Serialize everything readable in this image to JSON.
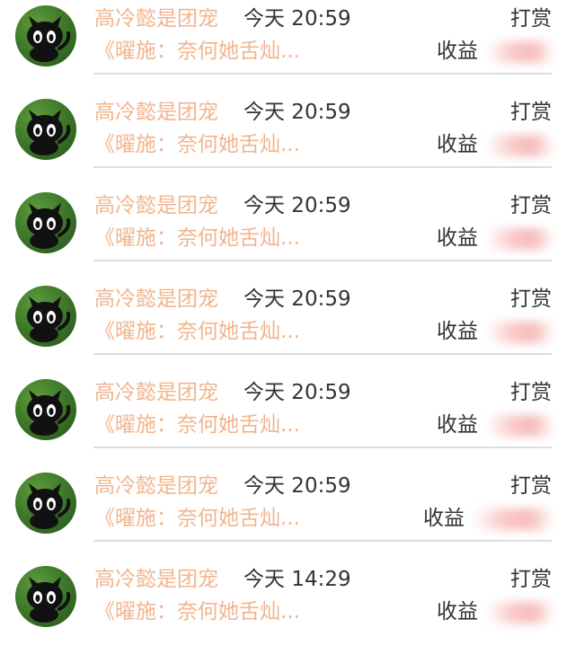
{
  "rewards": [
    {
      "name": "高冷懿是团宠",
      "time": "今天 20:59",
      "type": "打赏",
      "title": "《曜施：奈何她舌灿...",
      "income_label": "收益"
    },
    {
      "name": "高冷懿是团宠",
      "time": "今天 20:59",
      "type": "打赏",
      "title": "《曜施：奈何她舌灿...",
      "income_label": "收益"
    },
    {
      "name": "高冷懿是团宠",
      "time": "今天 20:59",
      "type": "打赏",
      "title": "《曜施：奈何她舌灿...",
      "income_label": "收益"
    },
    {
      "name": "高冷懿是团宠",
      "time": "今天 20:59",
      "type": "打赏",
      "title": "《曜施：奈何她舌灿...",
      "income_label": "收益"
    },
    {
      "name": "高冷懿是团宠",
      "time": "今天 20:59",
      "type": "打赏",
      "title": "《曜施：奈何她舌灿...",
      "income_label": "收益"
    },
    {
      "name": "高冷懿是团宠",
      "time": "今天 20:59",
      "type": "打赏",
      "title": "《曜施：奈何她舌灿...",
      "income_label": "收益"
    },
    {
      "name": "高冷懿是团宠",
      "time": "今天 14:29",
      "type": "打赏",
      "title": "《曜施：奈何她舌灿...",
      "income_label": "收益"
    }
  ],
  "colors": {
    "name_text": "#f0b58e",
    "primary_text": "#333333",
    "divider": "#dddddd",
    "avatar_bg": "#3f7a2a"
  },
  "icons": {
    "avatar": "cartoon-black-cat-avatar-icon"
  }
}
